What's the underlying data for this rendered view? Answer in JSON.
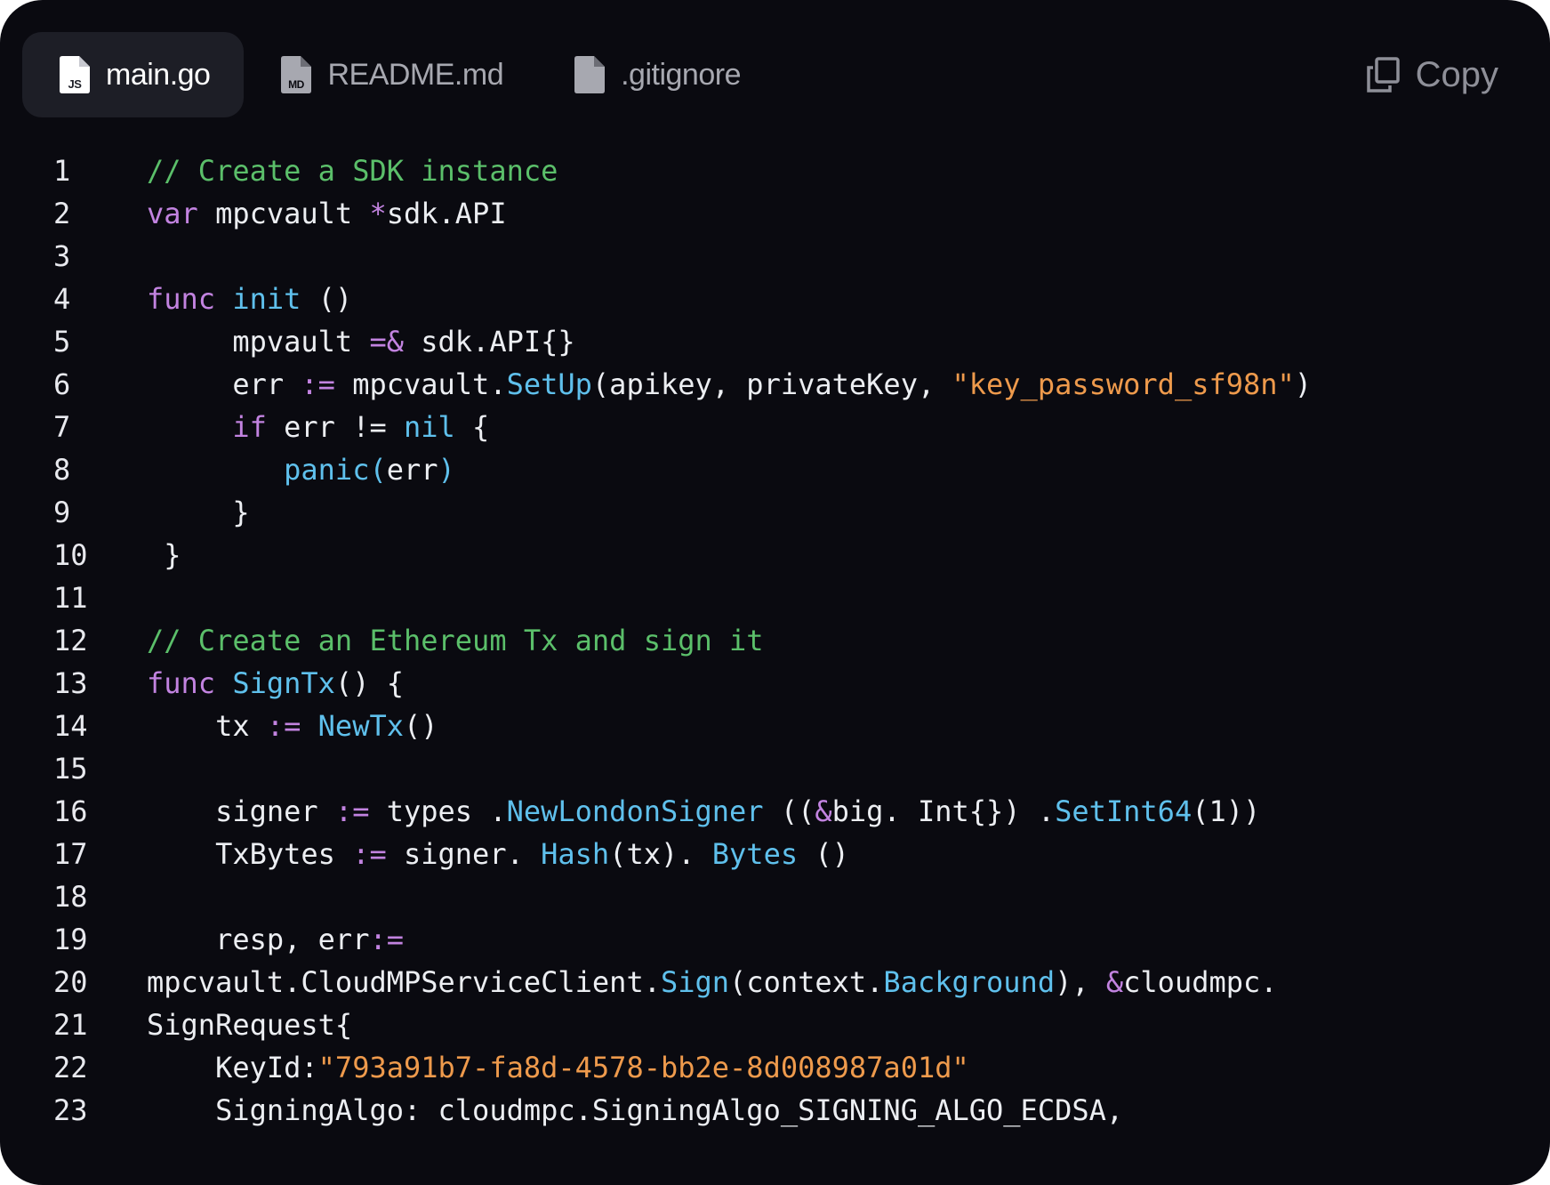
{
  "tabs": [
    {
      "label": "main.go",
      "badge": "JS",
      "active": true
    },
    {
      "label": "README.md",
      "badge": "MD",
      "active": false
    },
    {
      "label": ".gitignore",
      "badge": "",
      "active": false
    }
  ],
  "copy_label": "Copy",
  "icons": {
    "tab_file": "file-icon",
    "copy": "copy-icon"
  },
  "colors": {
    "background": "#0a0a10",
    "active_tab": "#1d1e26",
    "comment": "#5bbf6a",
    "keyword": "#c283e0",
    "function": "#5fc0ec",
    "string": "#ee9a4c",
    "text": "#eceef2"
  },
  "code_lines": [
    {
      "n": "1",
      "indent": "",
      "tokens": [
        [
          "c",
          "// Create a SDK instance"
        ]
      ]
    },
    {
      "n": "2",
      "indent": "",
      "tokens": [
        [
          "k",
          "var"
        ],
        [
          "t",
          " mpcvault "
        ],
        [
          "o",
          "*"
        ],
        [
          "t",
          "sdk.API"
        ]
      ]
    },
    {
      "n": "3",
      "indent": "",
      "tokens": []
    },
    {
      "n": "4",
      "indent": "",
      "tokens": [
        [
          "k",
          "func"
        ],
        [
          "t",
          " "
        ],
        [
          "f",
          "init"
        ],
        [
          "t",
          " ()"
        ]
      ]
    },
    {
      "n": "5",
      "indent": "     ",
      "tokens": [
        [
          "t",
          "mpvault "
        ],
        [
          "o",
          "=&"
        ],
        [
          "t",
          " sdk.API{}"
        ]
      ]
    },
    {
      "n": "6",
      "indent": "     ",
      "tokens": [
        [
          "t",
          "err "
        ],
        [
          "o",
          ":="
        ],
        [
          "t",
          " mpcvault."
        ],
        [
          "f",
          "SetUp"
        ],
        [
          "t",
          "(apikey, privateKey, "
        ],
        [
          "s",
          "\"key_password_sf98n\""
        ],
        [
          "t",
          ")"
        ]
      ]
    },
    {
      "n": "7",
      "indent": "     ",
      "tokens": [
        [
          "k",
          "if"
        ],
        [
          "t",
          " err != "
        ],
        [
          "f",
          "nil"
        ],
        [
          "t",
          " {"
        ]
      ]
    },
    {
      "n": "8",
      "indent": "        ",
      "tokens": [
        [
          "f",
          "panic("
        ],
        [
          "t",
          "err"
        ],
        [
          "f",
          ")"
        ]
      ]
    },
    {
      "n": "9",
      "indent": "     ",
      "tokens": [
        [
          "t",
          "}"
        ]
      ]
    },
    {
      "n": "10",
      "indent": " ",
      "tokens": [
        [
          "t",
          "}"
        ]
      ]
    },
    {
      "n": "11",
      "indent": "",
      "tokens": []
    },
    {
      "n": "12",
      "indent": "",
      "tokens": [
        [
          "c",
          "// Create an Ethereum Tx and sign it"
        ]
      ]
    },
    {
      "n": "13",
      "indent": "",
      "tokens": [
        [
          "k",
          "func"
        ],
        [
          "t",
          " "
        ],
        [
          "f",
          "SignTx"
        ],
        [
          "t",
          "() {"
        ]
      ]
    },
    {
      "n": "14",
      "indent": "    ",
      "tokens": [
        [
          "t",
          "tx "
        ],
        [
          "o",
          ":="
        ],
        [
          "t",
          " "
        ],
        [
          "f",
          "NewTx"
        ],
        [
          "t",
          "()"
        ]
      ]
    },
    {
      "n": "15",
      "indent": "",
      "tokens": []
    },
    {
      "n": "16",
      "indent": "    ",
      "tokens": [
        [
          "t",
          "signer "
        ],
        [
          "o",
          ":="
        ],
        [
          "t",
          " types ."
        ],
        [
          "f",
          "NewLondonSigner"
        ],
        [
          "t",
          " (("
        ],
        [
          "o",
          "&"
        ],
        [
          "t",
          "big. Int{}) ."
        ],
        [
          "f",
          "SetInt64"
        ],
        [
          "t",
          "(1))"
        ]
      ]
    },
    {
      "n": "17",
      "indent": "    ",
      "tokens": [
        [
          "t",
          "TxBytes "
        ],
        [
          "o",
          ":="
        ],
        [
          "t",
          " signer. "
        ],
        [
          "f",
          "Hash"
        ],
        [
          "t",
          "(tx). "
        ],
        [
          "f",
          "Bytes"
        ],
        [
          "t",
          " ()"
        ]
      ]
    },
    {
      "n": "18",
      "indent": "",
      "tokens": []
    },
    {
      "n": "19",
      "indent": "    ",
      "tokens": [
        [
          "t",
          "resp, err"
        ],
        [
          "o",
          ":="
        ]
      ]
    },
    {
      "n": "20",
      "indent": "",
      "tokens": [
        [
          "t",
          "mpcvault.CloudMPServiceClient."
        ],
        [
          "f",
          "Sign"
        ],
        [
          "t",
          "(context."
        ],
        [
          "f",
          "Background"
        ],
        [
          "t",
          "), "
        ],
        [
          "o",
          "&"
        ],
        [
          "t",
          "cloudmpc."
        ]
      ]
    },
    {
      "n": "21",
      "indent": "",
      "tokens": [
        [
          "t",
          "SignRequest{"
        ]
      ]
    },
    {
      "n": "22",
      "indent": "    ",
      "tokens": [
        [
          "t",
          "KeyId:"
        ],
        [
          "s",
          "\"793a91b7-fa8d-4578-bb2e-8d008987a01d\""
        ]
      ]
    },
    {
      "n": "23",
      "indent": "    ",
      "tokens": [
        [
          "t",
          "SigningAlgo: cloudmpc.SigningAlgo_SIGNING_ALGO_ECDSA,"
        ]
      ]
    }
  ]
}
